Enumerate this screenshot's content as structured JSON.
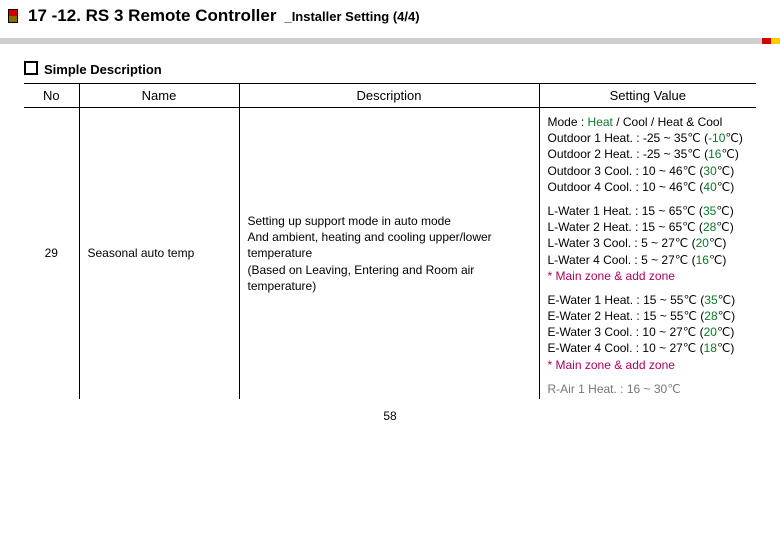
{
  "header": {
    "title_main": "17 -12. RS 3 Remote Controller",
    "title_sub": "_Installer Setting (4/4)"
  },
  "section_title": "Simple Description",
  "table": {
    "headers": {
      "no": "No",
      "name": "Name",
      "desc": "Description",
      "val": "Setting Value"
    },
    "row": {
      "no": "29",
      "name": "Seasonal auto temp",
      "desc": "Setting up support mode in auto mode\nAnd ambient, heating and cooling upper/lower temperature\n(Based on Leaving, Entering and Room air temperature)"
    }
  },
  "sv": {
    "block1": {
      "mode_label": "Mode : ",
      "mode_heat": "Heat",
      "mode_rest": " / Cool / Heat & Cool",
      "o1a": "Outdoor 1 Heat. : -25 ~ 35℃ (",
      "o1b": "-10",
      "o1c": "℃)",
      "o2a": "Outdoor 2 Heat. : -25 ~ 35℃ (",
      "o2b": "16",
      "o2c": "℃)",
      "o3a": "Outdoor 3 Cool. : 10 ~ 46℃ (",
      "o3b": "30",
      "o3c": "℃)",
      "o4a": "Outdoor 4 Cool. : 10 ~ 46℃ (",
      "o4b": "40",
      "o4c": "℃)"
    },
    "block2": {
      "l1a": "L-Water 1 Heat. : 15 ~ 65℃ (",
      "l1b": "35",
      "l1c": "℃)",
      "l2a": "L-Water 2 Heat. : 15 ~ 65℃ (",
      "l2b": "28",
      "l2c": "℃)",
      "l3a": "L-Water 3 Cool. : 5 ~ 27℃ (",
      "l3b": "20",
      "l3c": "℃)",
      "l4a": "L-Water 4 Cool. : 5 ~ 27℃ (",
      "l4b": "16",
      "l4c": "℃)",
      "note": "* Main zone & add zone"
    },
    "block3": {
      "e1a": "E-Water 1 Heat. : 15 ~ 55℃ (",
      "e1b": "35",
      "e1c": "℃)",
      "e2a": "E-Water 2 Heat. : 15 ~ 55℃ (",
      "e2b": "28",
      "e2c": "℃)",
      "e3a": "E-Water 3 Cool. : 10 ~ 27℃ (",
      "e3b": "20",
      "e3c": "℃)",
      "e4a": "E-Water 4 Cool. : 10 ~ 27℃ (",
      "e4b": "18",
      "e4c": "℃)",
      "note": "* Main zone & add zone"
    },
    "cutoff": "R-Air 1 Heat. : 16 ~ 30℃"
  },
  "page_number": "58"
}
